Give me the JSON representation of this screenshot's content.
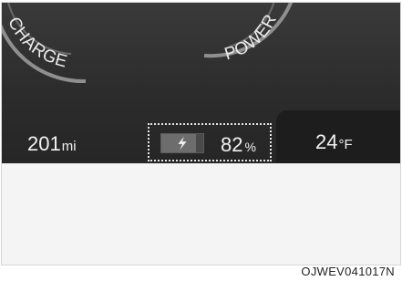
{
  "gauges": {
    "left_label": "CHARGE",
    "right_label": "POWER"
  },
  "status_bar": {
    "range_value": "201",
    "range_unit": "mi",
    "battery_percent": "82",
    "battery_unit": "%",
    "battery_level": 0.82,
    "battery_icon": "charging-bolt-icon",
    "temperature_value": "24",
    "temperature_unit": "°F"
  },
  "figure_code": "OJWEV041017N",
  "colors": {
    "display_bg": "#2e2e2e",
    "panel_bg": "#1d1d1d",
    "text": "#f2f2f2",
    "dotted_highlight": "#e6e6e6"
  }
}
